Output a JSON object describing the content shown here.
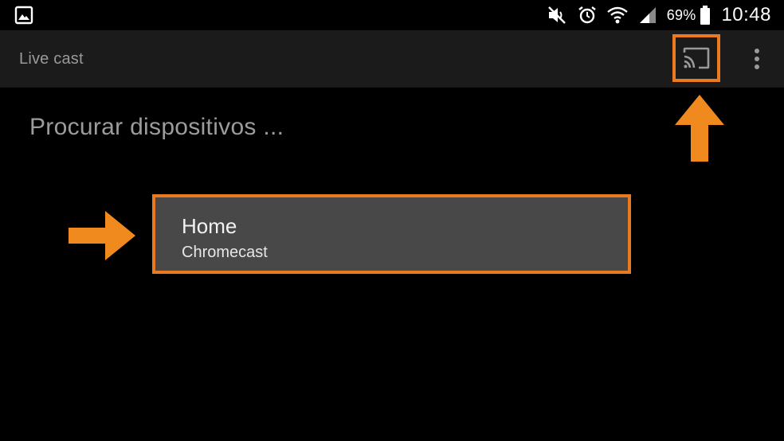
{
  "status_bar": {
    "battery_percent": "69%",
    "time": "10:48",
    "icons": [
      "gallery-icon",
      "mute-icon",
      "alarm-icon",
      "wifi-icon",
      "signal-icon",
      "battery-icon"
    ]
  },
  "app_bar": {
    "title": "Live cast",
    "icons": [
      "cast-icon",
      "overflow-menu-icon"
    ]
  },
  "main": {
    "search_label": "Procurar dispositivos ...",
    "devices": [
      {
        "name": "Home",
        "type": "Chromecast"
      }
    ]
  },
  "colors": {
    "highlight": "#ea7a1f",
    "app_bar_bg": "#1b1b1b",
    "background": "#000000",
    "device_bg": "#484848"
  }
}
